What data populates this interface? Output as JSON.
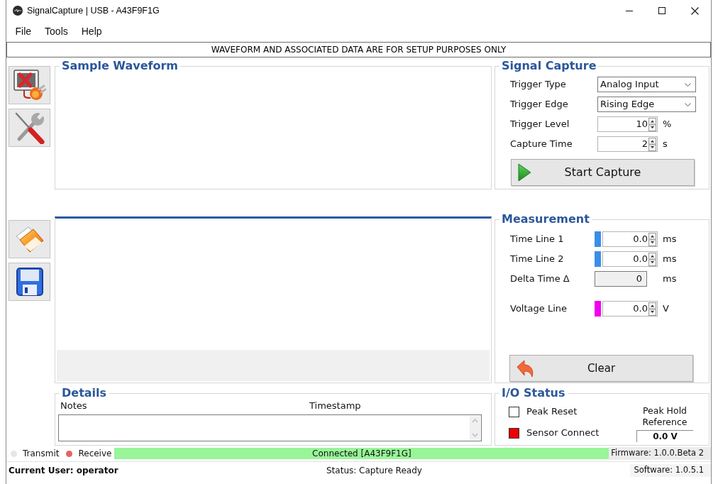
{
  "window": {
    "title": "SignalCapture | USB - A43F9F1G"
  },
  "menu": [
    "File",
    "Tools",
    "Help"
  ],
  "banner": "WAVEFORM AND ASSOCIATED DATA ARE FOR SETUP PURPOSES ONLY",
  "sample_waveform": {
    "title": "Sample Waveform"
  },
  "signal_capture": {
    "title": "Signal Capture",
    "fields": [
      {
        "kind": "dropdown",
        "label": "Trigger Type",
        "value": "Analog Input"
      },
      {
        "kind": "dropdown",
        "label": "Trigger Edge",
        "value": "Rising Edge"
      },
      {
        "kind": "spinner",
        "label": "Trigger Level",
        "value": "10",
        "unit": "%"
      },
      {
        "kind": "spinner",
        "label": "Capture Time",
        "value": "2",
        "unit": "s"
      }
    ],
    "button": "Start Capture"
  },
  "measurement": {
    "title": "Measurement",
    "fields": [
      {
        "kind": "spinner",
        "label": "Time Line 1",
        "value": "0.0",
        "unit": "ms",
        "color": "#3a8ee8"
      },
      {
        "kind": "spinner",
        "label": "Time Line 2",
        "value": "0.0",
        "unit": "ms",
        "color": "#3a8ee8"
      },
      {
        "kind": "readonly",
        "label": "Delta Time Δ",
        "value": "0",
        "unit": "ms"
      },
      {
        "kind": "spinner",
        "label": "Voltage Line",
        "value": "0.0",
        "unit": "V",
        "color": "#f000f0"
      }
    ],
    "button": "Clear"
  },
  "details": {
    "title": "Details",
    "columns": [
      "Notes",
      "Timestamp"
    ]
  },
  "io_status": {
    "title": "I/O Status",
    "indicators": [
      {
        "kind": "checkbox",
        "label": "Peak Reset",
        "checked": false
      },
      {
        "kind": "lamp",
        "label": "Sensor Connect",
        "on": true
      }
    ],
    "peak_hold": {
      "label": "Peak Hold Reference",
      "value": "0.0 V"
    }
  },
  "status_bar": {
    "lights": [
      {
        "label": "Transmit",
        "on": false
      },
      {
        "label": "Receive",
        "on": true
      }
    ],
    "connection": "Connected [A43F9F1G]",
    "firmware": "Firmware: 1.0.0.Beta 2",
    "user": "Current User: operator",
    "status": "Status: Capture Ready",
    "software": "Software: 1.0.5.1"
  }
}
